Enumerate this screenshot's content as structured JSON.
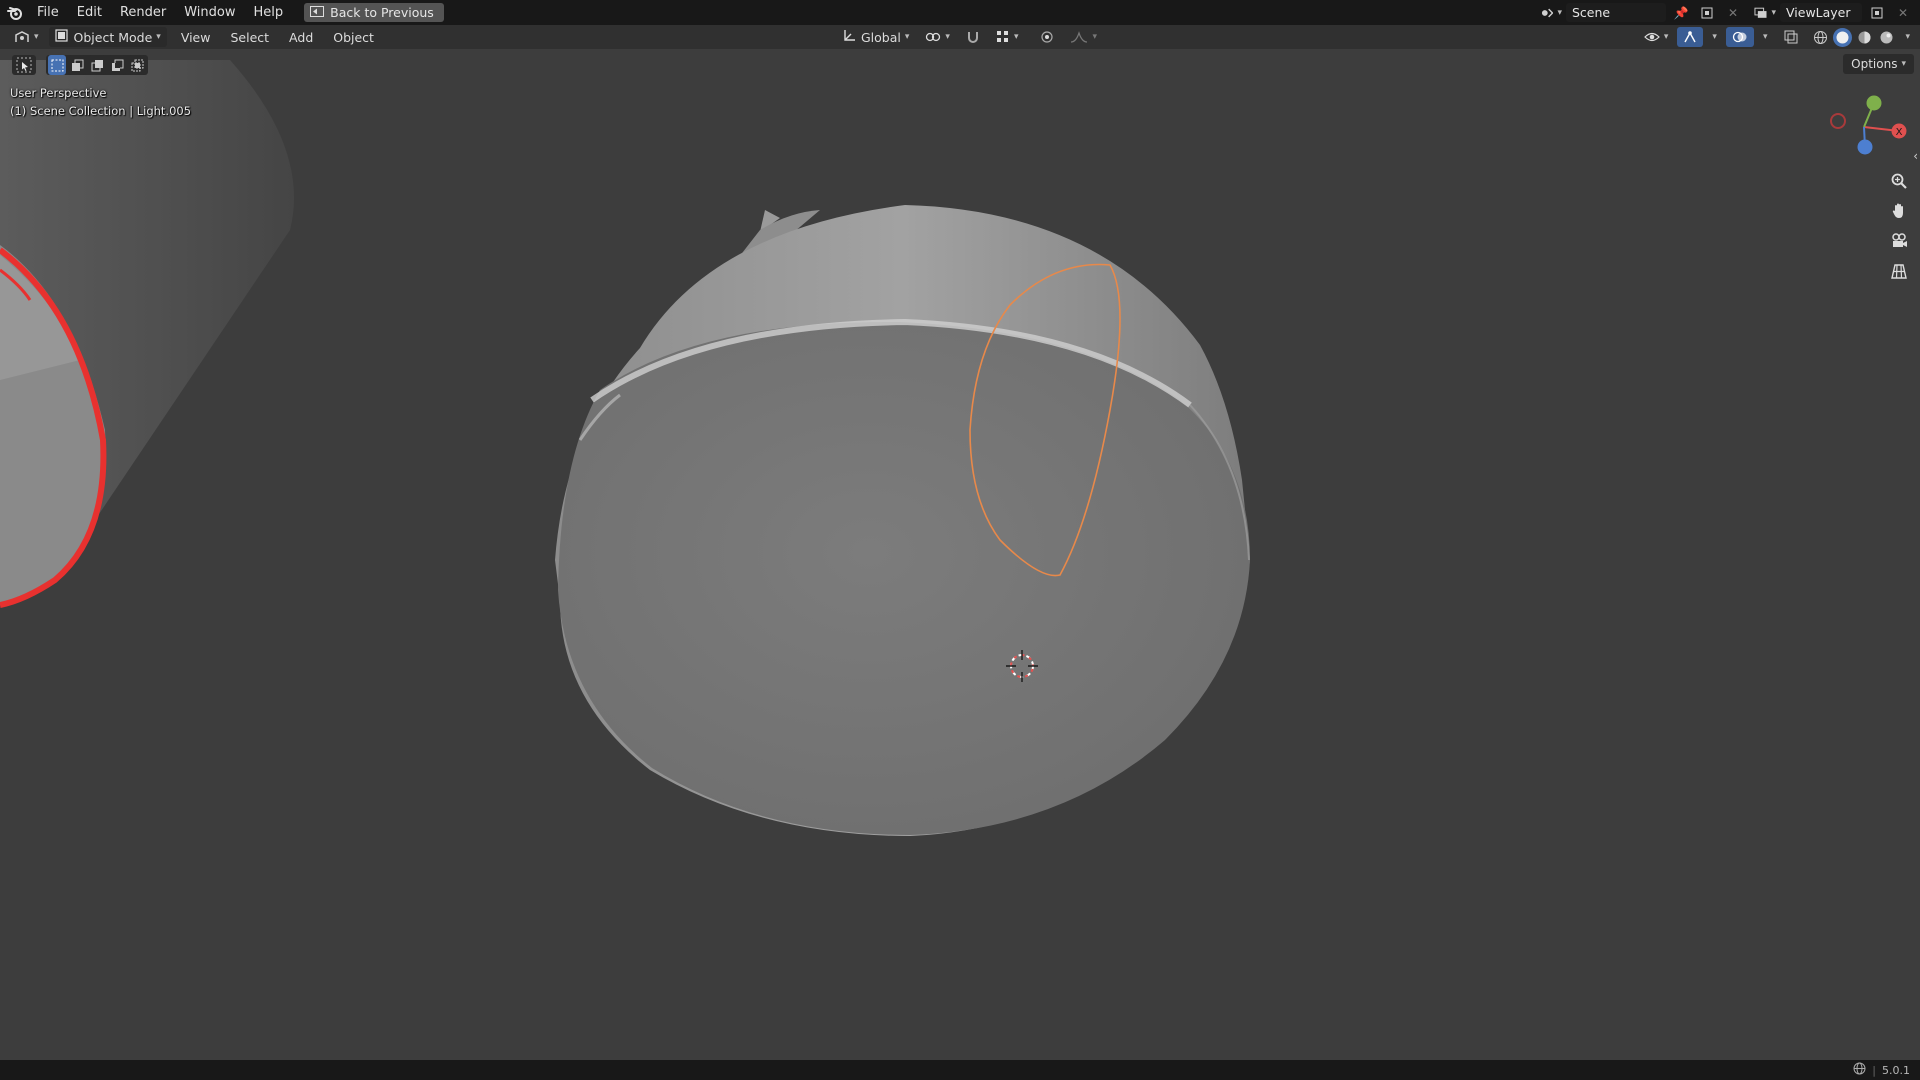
{
  "topbar": {
    "menu": [
      "File",
      "Edit",
      "Render",
      "Window",
      "Help"
    ],
    "back_button": "Back to Previous",
    "scene_name": "Scene",
    "view_layer": "ViewLayer"
  },
  "header": {
    "mode": "Object Mode",
    "menus": [
      "View",
      "Select",
      "Add",
      "Object"
    ],
    "orientation": "Global",
    "options_label": "Options"
  },
  "viewport": {
    "perspective_label": "User Perspective",
    "collection_label": "(1) Scene Collection | Light.005",
    "gizmo_axes": [
      "X",
      "Y",
      "Z"
    ],
    "selection_outline_color": "#e8312f",
    "light_outline_color": "#e8894a",
    "background_color": "#3d3d3d"
  },
  "statusbar": {
    "version": "5.0.1"
  },
  "icons": {
    "blender_logo": "blender-logo-icon",
    "zoom": "zoom-icon",
    "pan": "hand-pan-icon",
    "camera": "camera-view-icon",
    "ortho": "grid-ortho-icon"
  }
}
